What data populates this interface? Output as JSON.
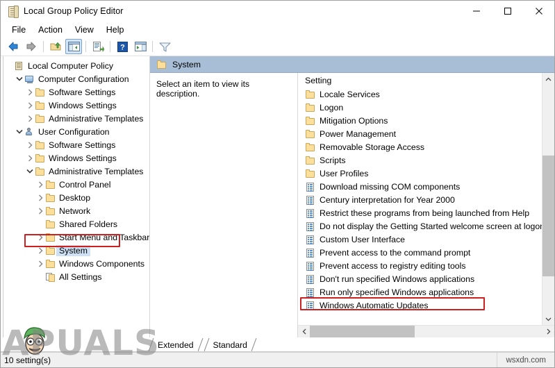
{
  "window": {
    "title": "Local Group Policy Editor",
    "icon": "policy-scroll-icon",
    "controls": {
      "minimize": "minimize-icon",
      "maximize": "maximize-icon",
      "close": "close-icon"
    }
  },
  "menubar": {
    "items": [
      {
        "label": "File"
      },
      {
        "label": "Action"
      },
      {
        "label": "View"
      },
      {
        "label": "Help"
      }
    ]
  },
  "toolbar": {
    "buttons": [
      {
        "name": "back-arrow-icon",
        "title": "Back"
      },
      {
        "name": "forward-arrow-icon",
        "title": "Forward"
      },
      {
        "name": "up-one-level-icon",
        "title": "Up One Level"
      },
      {
        "name": "show-hide-console-tree-icon",
        "title": "Show/Hide Console Tree",
        "active": true
      },
      {
        "name": "export-list-icon",
        "title": "Export List"
      },
      {
        "name": "help-icon",
        "title": "Help"
      },
      {
        "name": "properties-icon",
        "title": "Properties"
      },
      {
        "name": "filter-icon",
        "title": "Filter"
      }
    ]
  },
  "tree": {
    "nodes": [
      {
        "label": "Local Computer Policy",
        "icon": "scroll-icon",
        "indent": 0,
        "twisty": "",
        "selected": false
      },
      {
        "label": "Computer Configuration",
        "icon": "computer-icon",
        "indent": 1,
        "twisty": "v",
        "selected": false
      },
      {
        "label": "Software Settings",
        "icon": "folder-icon",
        "indent": 2,
        "twisty": ">",
        "selected": false
      },
      {
        "label": "Windows Settings",
        "icon": "folder-icon",
        "indent": 2,
        "twisty": ">",
        "selected": false
      },
      {
        "label": "Administrative Templates",
        "icon": "folder-icon",
        "indent": 2,
        "twisty": ">",
        "selected": false
      },
      {
        "label": "User Configuration",
        "icon": "user-icon",
        "indent": 1,
        "twisty": "v",
        "selected": false
      },
      {
        "label": "Software Settings",
        "icon": "folder-icon",
        "indent": 2,
        "twisty": ">",
        "selected": false
      },
      {
        "label": "Windows Settings",
        "icon": "folder-icon",
        "indent": 2,
        "twisty": ">",
        "selected": false
      },
      {
        "label": "Administrative Templates",
        "icon": "folder-icon",
        "indent": 2,
        "twisty": "v",
        "selected": false
      },
      {
        "label": "Control Panel",
        "icon": "folder-icon",
        "indent": 3,
        "twisty": ">",
        "selected": false
      },
      {
        "label": "Desktop",
        "icon": "folder-icon",
        "indent": 3,
        "twisty": ">",
        "selected": false
      },
      {
        "label": "Network",
        "icon": "folder-icon",
        "indent": 3,
        "twisty": ">",
        "selected": false
      },
      {
        "label": "Shared Folders",
        "icon": "folder-icon",
        "indent": 3,
        "twisty": "",
        "selected": false
      },
      {
        "label": "Start Menu and Taskbar",
        "icon": "folder-icon",
        "indent": 3,
        "twisty": ">",
        "selected": false
      },
      {
        "label": "System",
        "icon": "folder-icon",
        "indent": 3,
        "twisty": ">",
        "selected": true
      },
      {
        "label": "Windows Components",
        "icon": "folder-icon",
        "indent": 3,
        "twisty": ">",
        "selected": false
      },
      {
        "label": "All Settings",
        "icon": "all-settings-icon",
        "indent": 3,
        "twisty": "",
        "selected": false
      }
    ]
  },
  "right_pane": {
    "header": {
      "label": "System",
      "icon": "folder-icon"
    },
    "description": "Select an item to view its description.",
    "column_header": "Setting",
    "rows": [
      {
        "label": "Locale Services",
        "icon": "folder-icon",
        "highlighted": false
      },
      {
        "label": "Logon",
        "icon": "folder-icon",
        "highlighted": false
      },
      {
        "label": "Mitigation Options",
        "icon": "folder-icon",
        "highlighted": false
      },
      {
        "label": "Power Management",
        "icon": "folder-icon",
        "highlighted": false
      },
      {
        "label": "Removable Storage Access",
        "icon": "folder-icon",
        "highlighted": false
      },
      {
        "label": "Scripts",
        "icon": "folder-icon",
        "highlighted": false
      },
      {
        "label": "User Profiles",
        "icon": "folder-icon",
        "highlighted": false
      },
      {
        "label": "Download missing COM components",
        "icon": "policy-icon",
        "highlighted": false
      },
      {
        "label": "Century interpretation for Year 2000",
        "icon": "policy-icon",
        "highlighted": false
      },
      {
        "label": "Restrict these programs from being launched from Help",
        "icon": "policy-icon",
        "highlighted": false
      },
      {
        "label": "Do not display the Getting Started welcome screen at logon",
        "icon": "policy-icon",
        "highlighted": false
      },
      {
        "label": "Custom User Interface",
        "icon": "policy-icon",
        "highlighted": false
      },
      {
        "label": "Prevent access to the command prompt",
        "icon": "policy-icon",
        "highlighted": false
      },
      {
        "label": "Prevent access to registry editing tools",
        "icon": "policy-icon",
        "highlighted": false
      },
      {
        "label": "Don't run specified Windows applications",
        "icon": "policy-icon",
        "highlighted": true
      },
      {
        "label": "Run only specified Windows applications",
        "icon": "policy-icon",
        "highlighted": false
      },
      {
        "label": "Windows Automatic Updates",
        "icon": "policy-icon",
        "highlighted": false
      }
    ]
  },
  "tabs": [
    {
      "label": "Extended",
      "selected": false
    },
    {
      "label": "Standard",
      "selected": true
    }
  ],
  "statusbar": {
    "text": "10 setting(s)",
    "right_text": "wsxdn.com"
  },
  "watermark": {
    "text": "PUALS",
    "prefix": "A"
  },
  "colors": {
    "pane_header": "#a8bed6",
    "selection": "#cde0f4",
    "annotation_red": "#cc1f1f",
    "toolbar_active": "#d4e6f7"
  }
}
